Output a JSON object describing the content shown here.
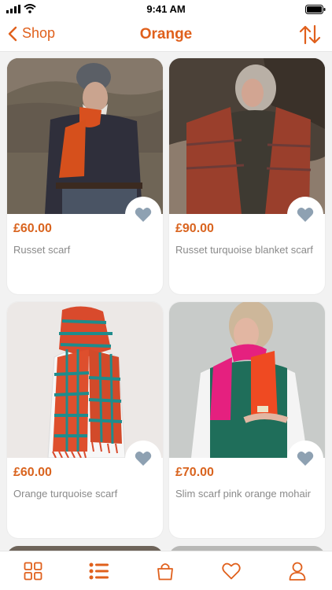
{
  "status": {
    "time": "9:41 AM"
  },
  "nav": {
    "back_label": "Shop",
    "title": "Orange"
  },
  "products": [
    {
      "price": "£60.00",
      "name": "Russet scarf"
    },
    {
      "price": "£90.00",
      "name": "Russet turquoise blanket scarf"
    },
    {
      "price": "£60.00",
      "name": "Orange turquoise scarf"
    },
    {
      "price": "£70.00",
      "name": "Slim scarf pink orange mohair"
    }
  ],
  "colors": {
    "accent": "#e0601c",
    "price": "#d9641f",
    "heart": "#8ea1b2"
  },
  "icons": {
    "tab_bar": [
      "grid-icon",
      "list-icon",
      "bag-icon",
      "heart-icon",
      "profile-icon"
    ]
  }
}
